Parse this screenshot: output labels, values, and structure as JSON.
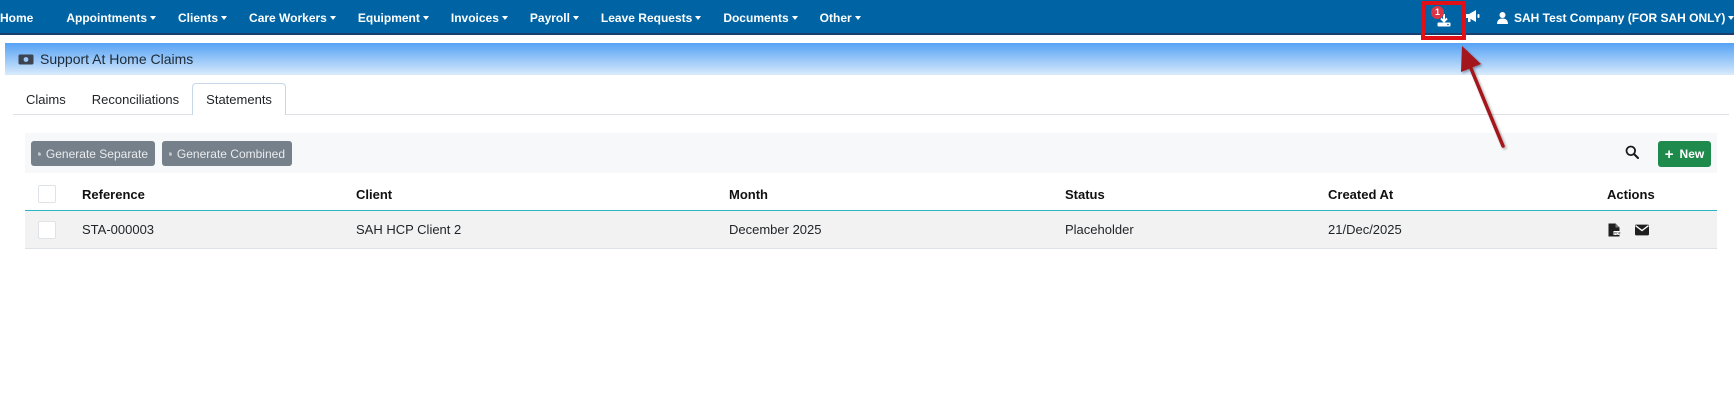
{
  "navbar": {
    "items": [
      {
        "label": "Home",
        "has_caret": false
      },
      {
        "label": "Appointments",
        "has_caret": true
      },
      {
        "label": "Clients",
        "has_caret": true
      },
      {
        "label": "Care Workers",
        "has_caret": true
      },
      {
        "label": "Equipment",
        "has_caret": true
      },
      {
        "label": "Invoices",
        "has_caret": true
      },
      {
        "label": "Payroll",
        "has_caret": true
      },
      {
        "label": "Leave Requests",
        "has_caret": true
      },
      {
        "label": "Documents",
        "has_caret": true
      },
      {
        "label": "Other",
        "has_caret": true
      }
    ],
    "download_badge": "1",
    "download_icon": "download-tray-icon",
    "announcement_icon": "megaphone-icon",
    "user_icon": "user-icon",
    "user_label": "SAH Test Company (FOR SAH ONLY)",
    "background_color": "#0064a4",
    "highlight_color": "#e10f16"
  },
  "page": {
    "title": "Support At Home Claims",
    "title_icon": "money-bill-icon"
  },
  "tabs": [
    {
      "label": "Claims",
      "active": false
    },
    {
      "label": "Reconciliations",
      "active": false
    },
    {
      "label": "Statements",
      "active": true
    }
  ],
  "toolbar": {
    "generate_separate_label": "Generate Separate",
    "generate_combined_label": "Generate Combined",
    "search_icon": "search-icon",
    "new_label": "New",
    "new_color": "#1e8a4c"
  },
  "table": {
    "columns": [
      "Reference",
      "Client",
      "Month",
      "Status",
      "Created At",
      "Actions"
    ],
    "rows": [
      {
        "reference": "STA-000003",
        "client": "SAH HCP Client 2",
        "month": "December 2025",
        "status": "Placeholder",
        "created_at": "21/Dec/2025",
        "actions": [
          "pdf-file-icon",
          "envelope-icon"
        ]
      }
    ]
  },
  "annotation": {
    "arrow_color": "#a3131b"
  }
}
